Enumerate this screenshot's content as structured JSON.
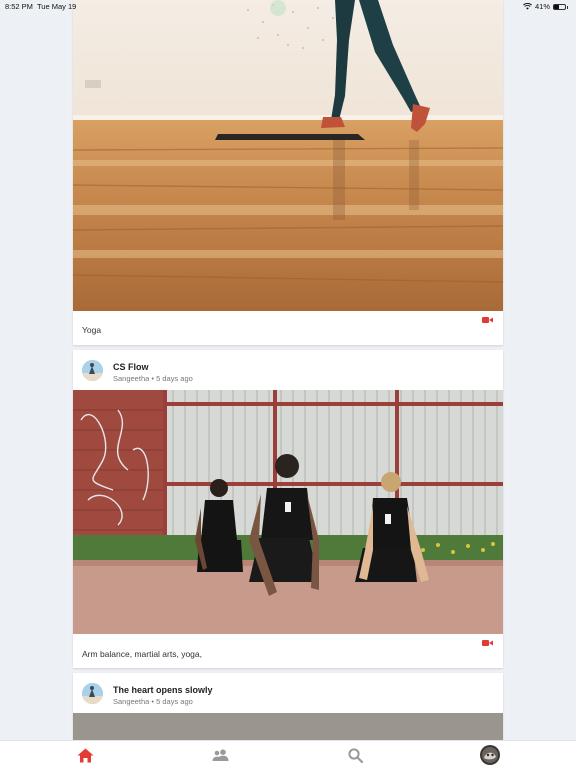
{
  "status_bar": {
    "time": "8:52 PM",
    "date": "Tue May 19",
    "battery": "41%",
    "battery_level": 0.41
  },
  "feed": {
    "posts": [
      {
        "caption": "Yoga",
        "media_type": "video"
      },
      {
        "title": "CS Flow",
        "author": "Sangeetha",
        "age": "5 days ago",
        "caption": "Arm balance, martial arts, yoga,",
        "media_type": "video"
      },
      {
        "title": "The heart opens slowly",
        "author": "Sangeetha",
        "age": "5 days ago"
      }
    ]
  },
  "tab_bar": {
    "tabs": [
      {
        "icon": "home-icon",
        "active": true
      },
      {
        "icon": "people-icon",
        "active": false
      },
      {
        "icon": "search-icon",
        "active": false
      },
      {
        "icon": "profile-avatar",
        "active": false
      }
    ]
  },
  "colors": {
    "accent": "#e53935",
    "background": "#edf0f4",
    "inactive_icon": "#9a9a9a"
  }
}
